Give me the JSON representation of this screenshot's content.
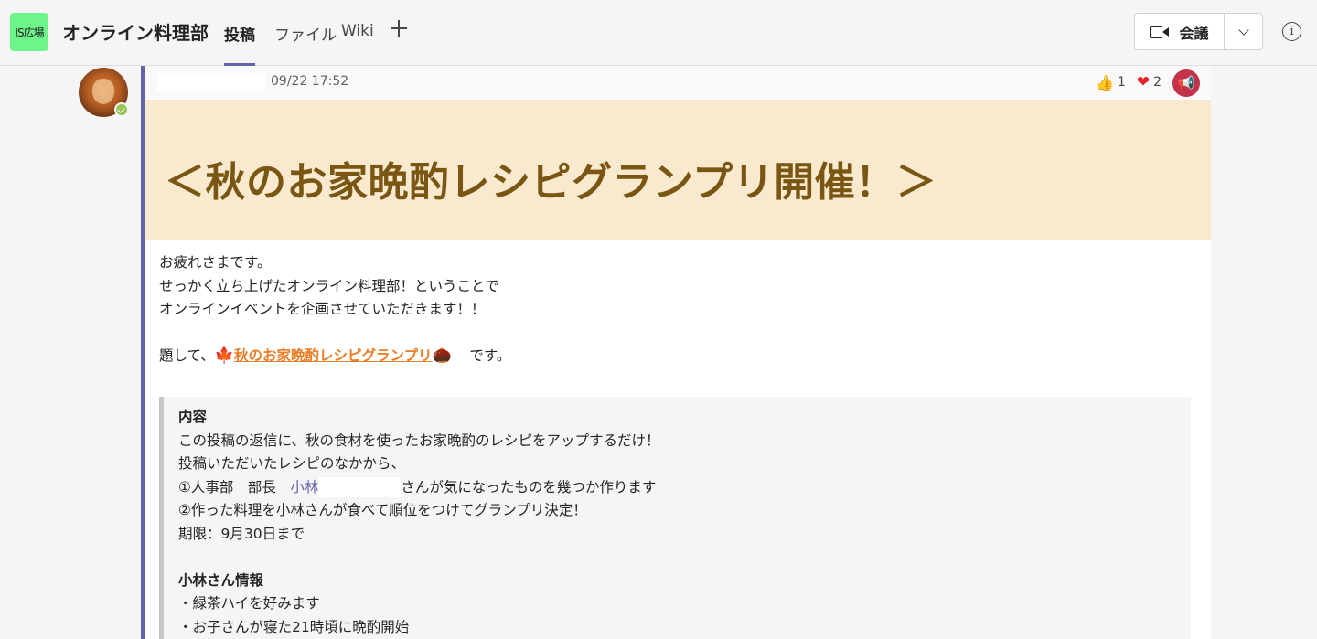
{
  "team": {
    "logo_text": "IS広場",
    "name": "オンライン料理部"
  },
  "tabs": [
    {
      "label": "投稿",
      "active": true
    },
    {
      "label": "ファイル",
      "active": false
    },
    {
      "label": "Wiki",
      "active": false
    }
  ],
  "header": {
    "meeting_label": "会議",
    "info_glyph": "i",
    "add_tab_icon": "plus-icon"
  },
  "post": {
    "timestamp": "09/22 17:52",
    "reactions": {
      "like_count": "1",
      "heart_count": "2"
    },
    "banner_title": "＜秋のお家晩酌レシピグランプリ開催！＞",
    "body": {
      "line1": "お疲れさまです。",
      "line2": "せっかく立ち上げたオンライン料理部！ということで",
      "line3": "オンラインイベントを企画させていただきます！！",
      "line4_prefix": "題して、",
      "line4_highlight": "秋のお家晩酌レシピグランプリ",
      "line4_suffix": "です。"
    },
    "quote": {
      "heading1": "内容",
      "line1": "この投稿の返信に、秋の食材を使ったお家晩酌のレシピをアップするだけ！",
      "line2": "投稿いただいたレシピのなかから、",
      "line3_prefix": "①人事部　部長　",
      "line3_mention": "小林",
      "line3_suffix": "さんが気になったものを幾つか作ります",
      "line4": "②作った料理を小林さんが食べて順位をつけてグランプリ決定！",
      "line5": "期限：9月30日まで",
      "heading2": "小林さん情報",
      "line6": "・緑茶ハイを好みます",
      "line7": "・お子さんが寝た21時頃に晩酌開始"
    }
  },
  "colors": {
    "accent": "#6264a7",
    "banner_bg": "#f8e9cf",
    "banner_text": "#7a5613",
    "highlight": "#e97d25",
    "team_logo_bg": "#6ef58a"
  }
}
